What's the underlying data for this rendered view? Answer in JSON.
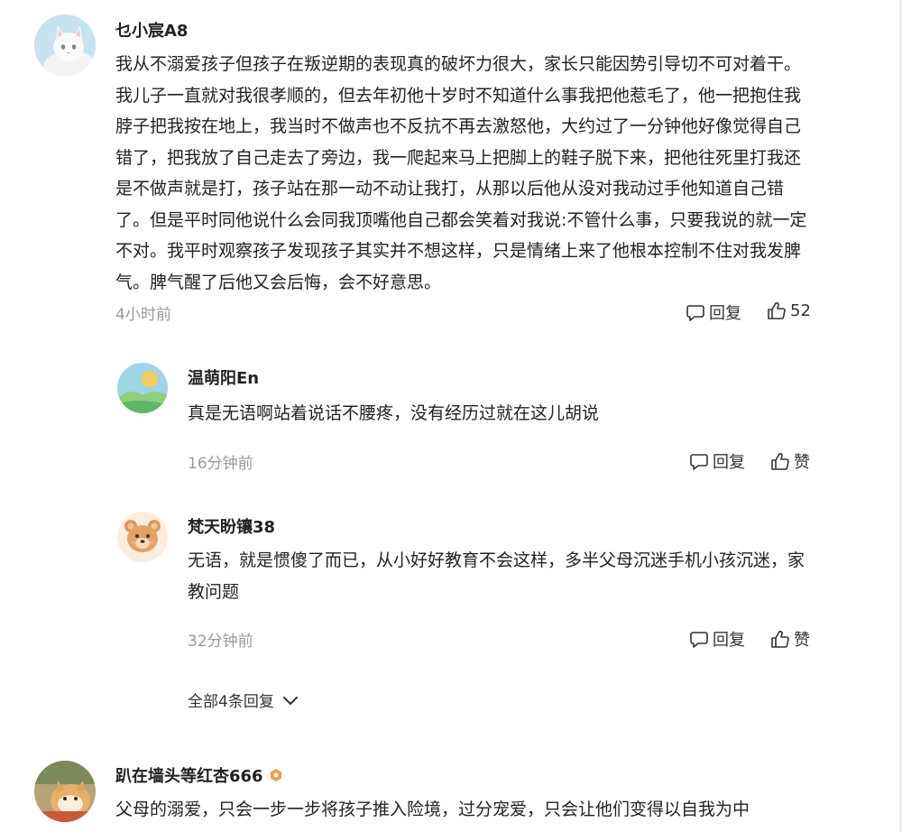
{
  "comments": [
    {
      "author": "乜小宸A8",
      "text": "我从不溺爱孩子但孩子在叛逆期的表现真的破坏力很大，家长只能因势引导切不可对着干。我儿子一直就对我很孝顺的，但去年初他十岁时不知道什么事我把他惹毛了，他一把抱住我脖子把我按在地上，我当时不做声也不反抗不再去激怒他，大约过了一分钟他好像觉得自己错了，把我放了自己走去了旁边，我一爬起来马上把脚上的鞋子脱下来，把他往死里打我还是不做声就是打，孩子站在那一动不动让我打，从那以后他从没对我动过手他知道自己错了。但是平时同他说什么会同我顶嘴他自己都会笑着对我说:不管什么事，只要我说的就一定不对。我平时观察孩子发现孩子其实并不想这样，只是情绪上来了他根本控制不住对我发脾气。脾气醒了后他又会后悔，会不好意思。",
      "time": "4小时前",
      "reply_label": "回复",
      "like_label": "52",
      "avatar_icon": "white-cat-avatar"
    }
  ],
  "replies": [
    {
      "author": "温萌阳En",
      "text": "真是无语啊站着说话不腰疼，没有经历过就在这儿胡说",
      "time": "16分钟前",
      "reply_label": "回复",
      "like_label": "赞",
      "avatar_icon": "landscape-avatar"
    },
    {
      "author": "梵天盼镶38",
      "text": "无语，就是惯傻了而已，从小好好教育不会这样，多半父母沉迷手机小孩沉迷，家教问题",
      "time": "32分钟前",
      "reply_label": "回复",
      "like_label": "赞",
      "avatar_icon": "bear-avatar"
    }
  ],
  "more_replies_label": "全部4条回复",
  "next_comment": {
    "author": "趴在墙头等红杏666",
    "badge_icon": "level-badge-icon",
    "text": "父母的溺爱，只会一步一步将孩子推入险境，过分宠爱，只会让他们变得以自我为中",
    "avatar_icon": "cat-photo-avatar"
  }
}
